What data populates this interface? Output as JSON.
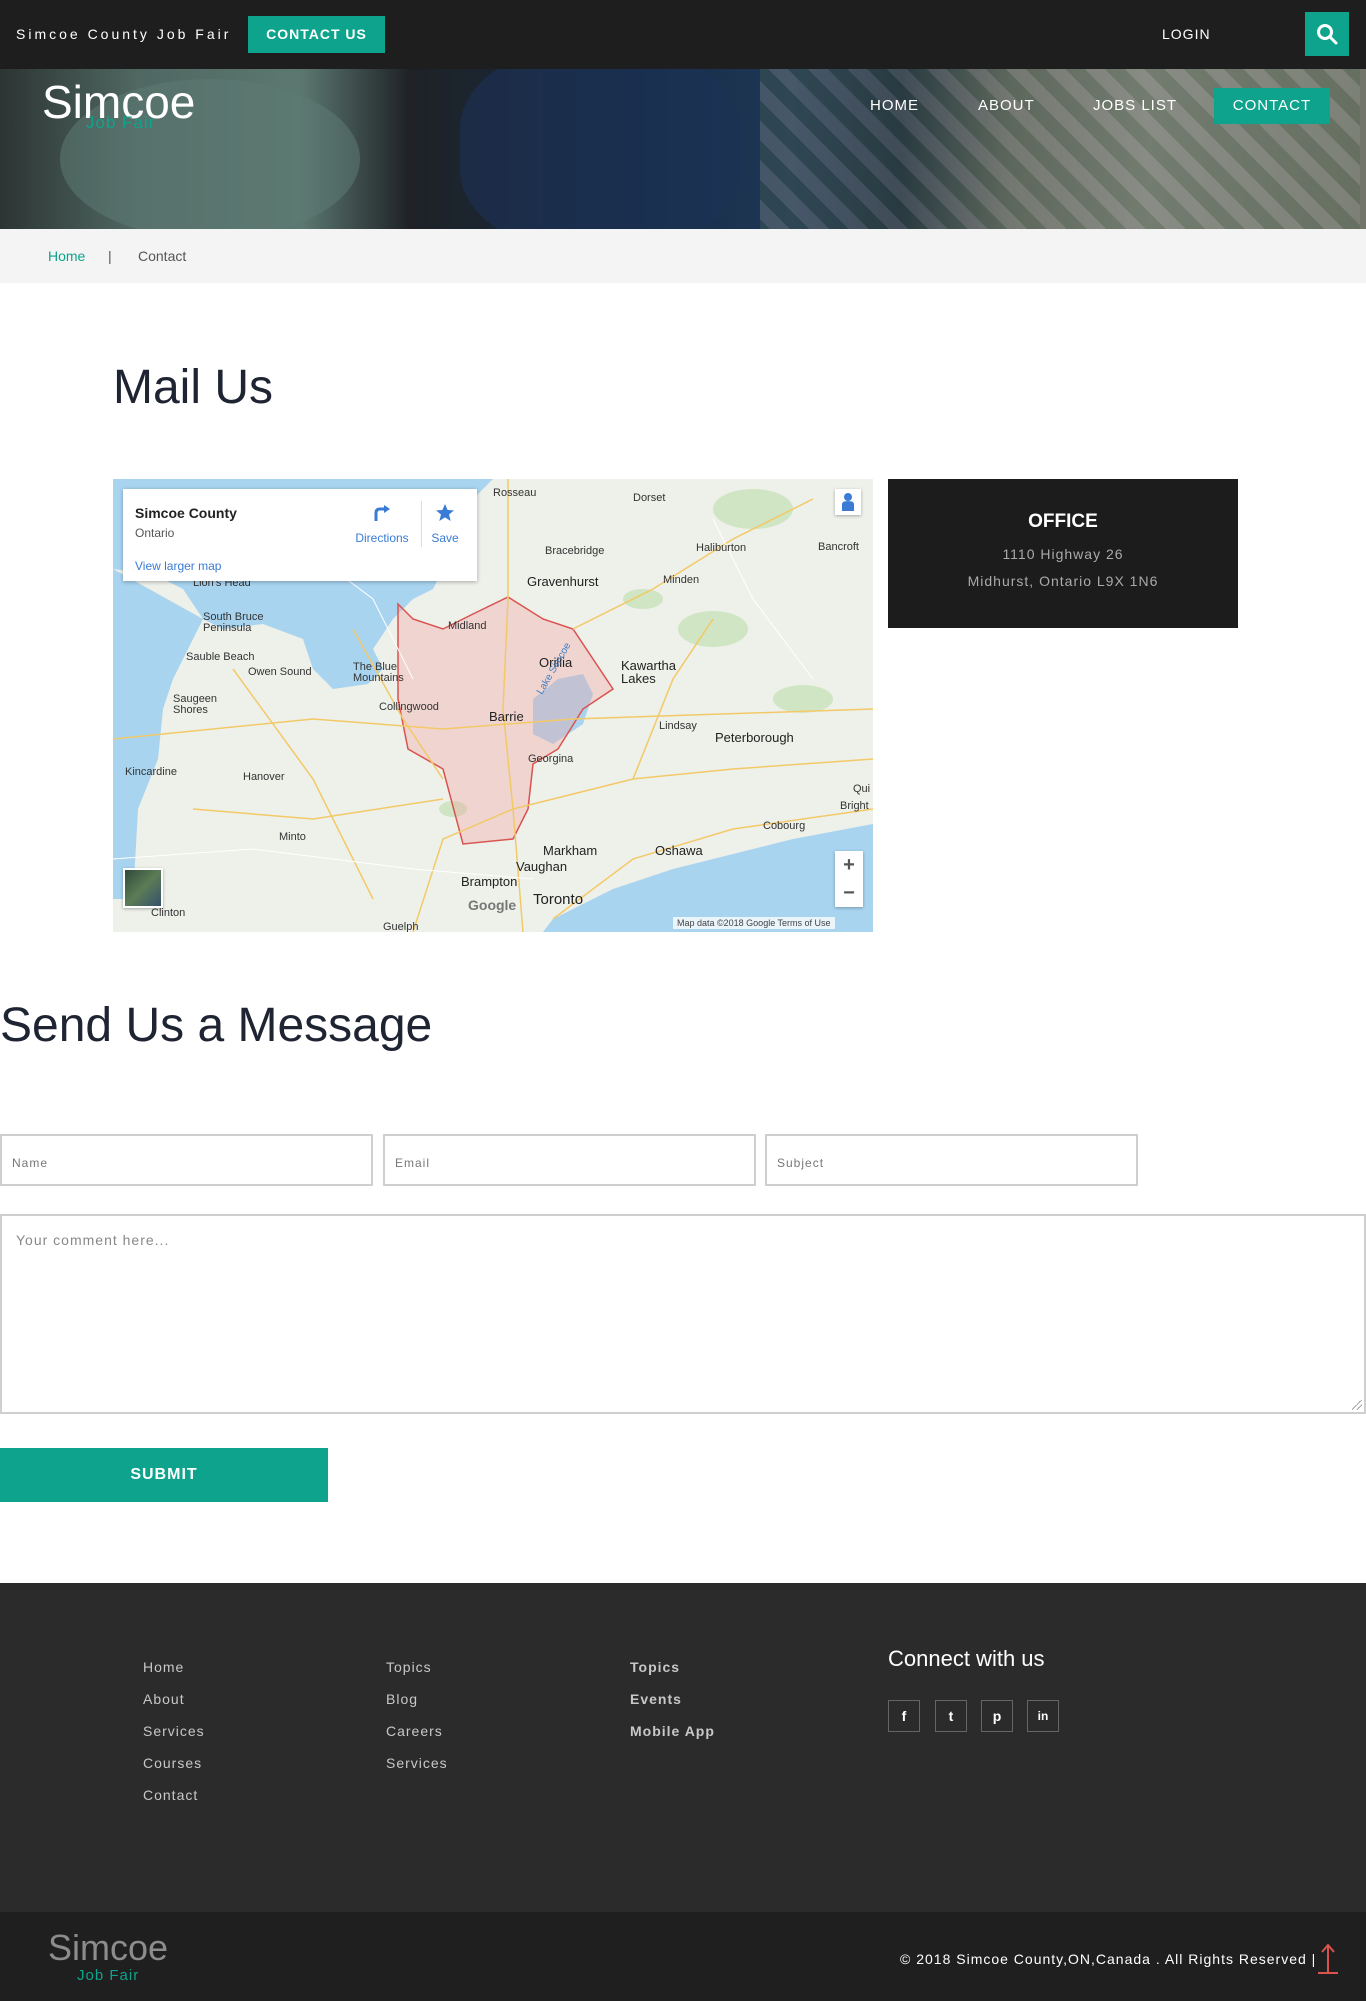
{
  "topbar": {
    "brand": "Simcoe County Job Fair",
    "contact_btn": "CONTACT US",
    "login": "LOGIN",
    "search_icon": "search-icon"
  },
  "header": {
    "logo_title": "Simcoe",
    "logo_sub": "Job Fair",
    "nav": [
      {
        "label": "HOME"
      },
      {
        "label": "ABOUT"
      },
      {
        "label": "JOBS LIST"
      },
      {
        "label": "CONTACT"
      }
    ]
  },
  "breadcrumb": {
    "home": "Home",
    "separator": "|",
    "current": "Contact"
  },
  "mail_section": {
    "heading": "Mail Us"
  },
  "map": {
    "place": "Simcoe County",
    "region": "Ontario",
    "larger_link": "View larger map",
    "directions": "Directions",
    "save": "Save",
    "zoom_in": "+",
    "zoom_out": "−",
    "attribution": "Map data ©2018 Google   Terms of Use",
    "google": "Google",
    "cities": [
      "Rosseau",
      "Dorset",
      "Bracebridge",
      "Haliburton",
      "Bancroft",
      "Lion's Head",
      "Gravenhurst",
      "Minden",
      "South Bruce Peninsula",
      "Midland",
      "Sauble Beach",
      "Owen Sound",
      "The Blue Mountains",
      "Orillia",
      "Kawartha Lakes",
      "Saugeen Shores",
      "Collingwood",
      "Barrie",
      "Lindsay",
      "Peterborough",
      "Kincardine",
      "Hanover",
      "Georgina",
      "Minto",
      "Cobourg",
      "Markham",
      "Oshawa",
      "Brampton",
      "Vaughan",
      "Toronto",
      "Clinton",
      "Guelph",
      "Lake Simcoe",
      "Qui",
      "Bright"
    ]
  },
  "office": {
    "title": "OFFICE",
    "line1": "1110 Highway 26",
    "line2": "Midhurst, Ontario L9X 1N6"
  },
  "message_section": {
    "heading": "Send Us a Message",
    "name_placeholder": "Name",
    "email_placeholder": "Email",
    "subject_placeholder": "Subject",
    "comment_placeholder": "Your comment here...",
    "submit": "SUBMIT"
  },
  "footer": {
    "col1": [
      "Home",
      "About",
      "Services",
      "Courses",
      "Contact"
    ],
    "col2": [
      "Topics",
      "Blog",
      "Careers",
      "Services"
    ],
    "col3": [
      "Topics",
      "Events",
      "Mobile App"
    ],
    "connect_title": "Connect with us",
    "social": [
      {
        "icon": "facebook-icon",
        "glyph": "f"
      },
      {
        "icon": "twitter-icon",
        "glyph": "t"
      },
      {
        "icon": "pinterest-icon",
        "glyph": "p"
      },
      {
        "icon": "linkedin-icon",
        "glyph": "in"
      }
    ],
    "bottom_logo_title": "Simcoe",
    "bottom_logo_sub": "Job Fair",
    "copyright": "© 2018 Simcoe County,ON,Canada . All Rights Reserved |"
  },
  "colors": {
    "accent": "#0ea38c",
    "dark": "#1e1e1e",
    "footer": "#2b2b2b"
  }
}
